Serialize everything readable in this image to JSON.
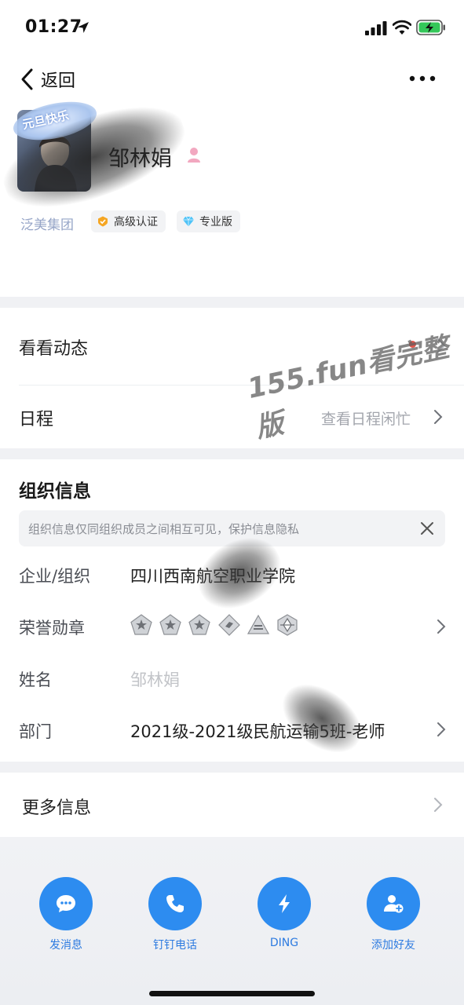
{
  "status_bar": {
    "time": "01:27"
  },
  "nav": {
    "back_label": "返回"
  },
  "profile": {
    "name": "邹林娟",
    "org_name": "泛美集团",
    "avatar_badge_text": "元旦快乐",
    "tags": [
      {
        "label": "高级认证",
        "icon": "certified-icon"
      },
      {
        "label": "专业版",
        "icon": "diamond-icon"
      }
    ]
  },
  "rows": {
    "moments": {
      "label": "看看动态"
    },
    "schedule": {
      "label": "日程",
      "value": "查看日程闲忙"
    }
  },
  "watermark": "155.fun看完整版",
  "org_info": {
    "title": "组织信息",
    "notice": "组织信息仅同组织成员之间相互可见，保护信息隐私",
    "fields": [
      {
        "label": "企业/组织",
        "value": "四川西南航空职业学院"
      },
      {
        "label": "荣誉勋章",
        "value": ""
      },
      {
        "label": "姓名",
        "value": "邹林娟"
      },
      {
        "label": "部门",
        "value": "2021级-2021级民航运输5班-老师"
      }
    ]
  },
  "more_info": {
    "label": "更多信息"
  },
  "actions": [
    {
      "label": "发消息",
      "icon": "message-icon"
    },
    {
      "label": "钉钉电话",
      "icon": "phone-icon"
    },
    {
      "label": "DING",
      "icon": "lightning-icon"
    },
    {
      "label": "添加好友",
      "icon": "add-friend-icon"
    }
  ],
  "colors": {
    "accent": "#2d8cf0",
    "separator": "#f0f1f4",
    "notification_dot": "#e5554b"
  }
}
